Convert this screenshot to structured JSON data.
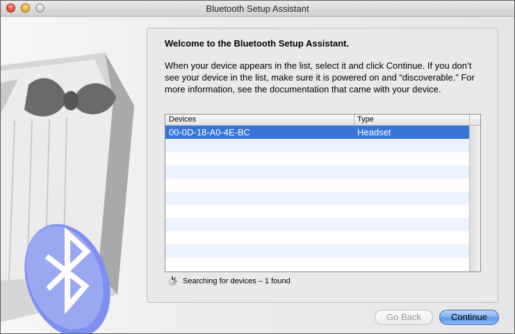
{
  "window": {
    "title": "Bluetooth Setup Assistant"
  },
  "main": {
    "heading": "Welcome to the Bluetooth Setup Assistant.",
    "description": "When your device appears in the list, select it and click Continue. If you don’t see your device in the list, make sure it is powered on and “discoverable.” For more information, see the documentation that came with your device."
  },
  "table": {
    "columns": [
      "Devices",
      "Type"
    ],
    "rows": [
      {
        "device": "00-0D-18-A0-4E-BC",
        "type": "Headset",
        "selected": true
      }
    ]
  },
  "status": {
    "text": "Searching for devices – 1 found"
  },
  "buttons": {
    "back": "Go Back",
    "continue": "Continue"
  },
  "colors": {
    "selection": "#3875d7",
    "alternate_row": "#edf3fe",
    "bluetooth_badge": "#7f8ff0"
  },
  "icons": {
    "sidebar_art": "tuxedo-bowtie-illustration",
    "badge": "bluetooth-icon",
    "spinner": "progress-spinner-icon"
  }
}
